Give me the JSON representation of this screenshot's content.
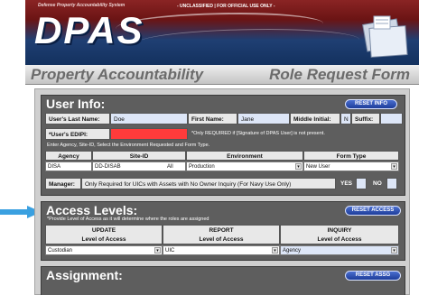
{
  "header": {
    "system_name": "Defense Property Accountability System",
    "classification": "- UNCLASSIFIED | FOR OFFICIAL USE ONLY -",
    "logo": "DPAS",
    "subtitle_left": "Property Accountability",
    "subtitle_right": "Role Request Form"
  },
  "user_info": {
    "title": "User Info:",
    "reset_label": "RESET INFO",
    "last_name_label": "User's Last Name:",
    "last_name_value": "Doe",
    "first_name_label": "First Name:",
    "first_name_value": "Jane",
    "middle_initial_label": "Middle Initial:",
    "middle_initial_value": "N",
    "suffix_label": "Suffix:",
    "suffix_value": "",
    "edipi_label": "*User's EDIPI:",
    "edipi_value": "",
    "edipi_note": "*Only REQUIRED if [Signature of DPAS User] is not present.",
    "instruction": "Enter Agency, Site-ID, Select the Environment Requested and Form Type.",
    "col_agency": "Agency",
    "col_site": "Site-ID",
    "col_env": "Environment",
    "col_form": "Form Type",
    "agency_value": "DISA",
    "site_value": "DD-DISAB",
    "site_all": "All",
    "env_value": "Production",
    "form_value": "New User",
    "manager_label": "Manager:",
    "manager_note": "Only Required for UICs with Assets with No Owner Inquiry (For Navy Use Only)",
    "yes_label": "YES",
    "no_label": "NO"
  },
  "access_levels": {
    "title": "Access Levels:",
    "reset_label": "RESET ACCESS",
    "note": "*Provide Level of Access as it will determine where the roles are assigned",
    "col_update_1": "UPDATE",
    "col_update_2": "Level of Access",
    "col_report_1": "REPORT",
    "col_report_2": "Level of Access",
    "col_inquiry_1": "INQUIRY",
    "col_inquiry_2": "Level of Access",
    "update_value": "Custodian",
    "report_value": "UIC",
    "inquiry_value": "Agency"
  },
  "assignment": {
    "title": "Assignment:",
    "reset_label": "RESET ASSG"
  },
  "colors": {
    "panel": "#5e5e5e",
    "button": "#1e3d9a",
    "edipi_highlight": "#ff3b3b",
    "arrow": "#3aa0e0"
  }
}
